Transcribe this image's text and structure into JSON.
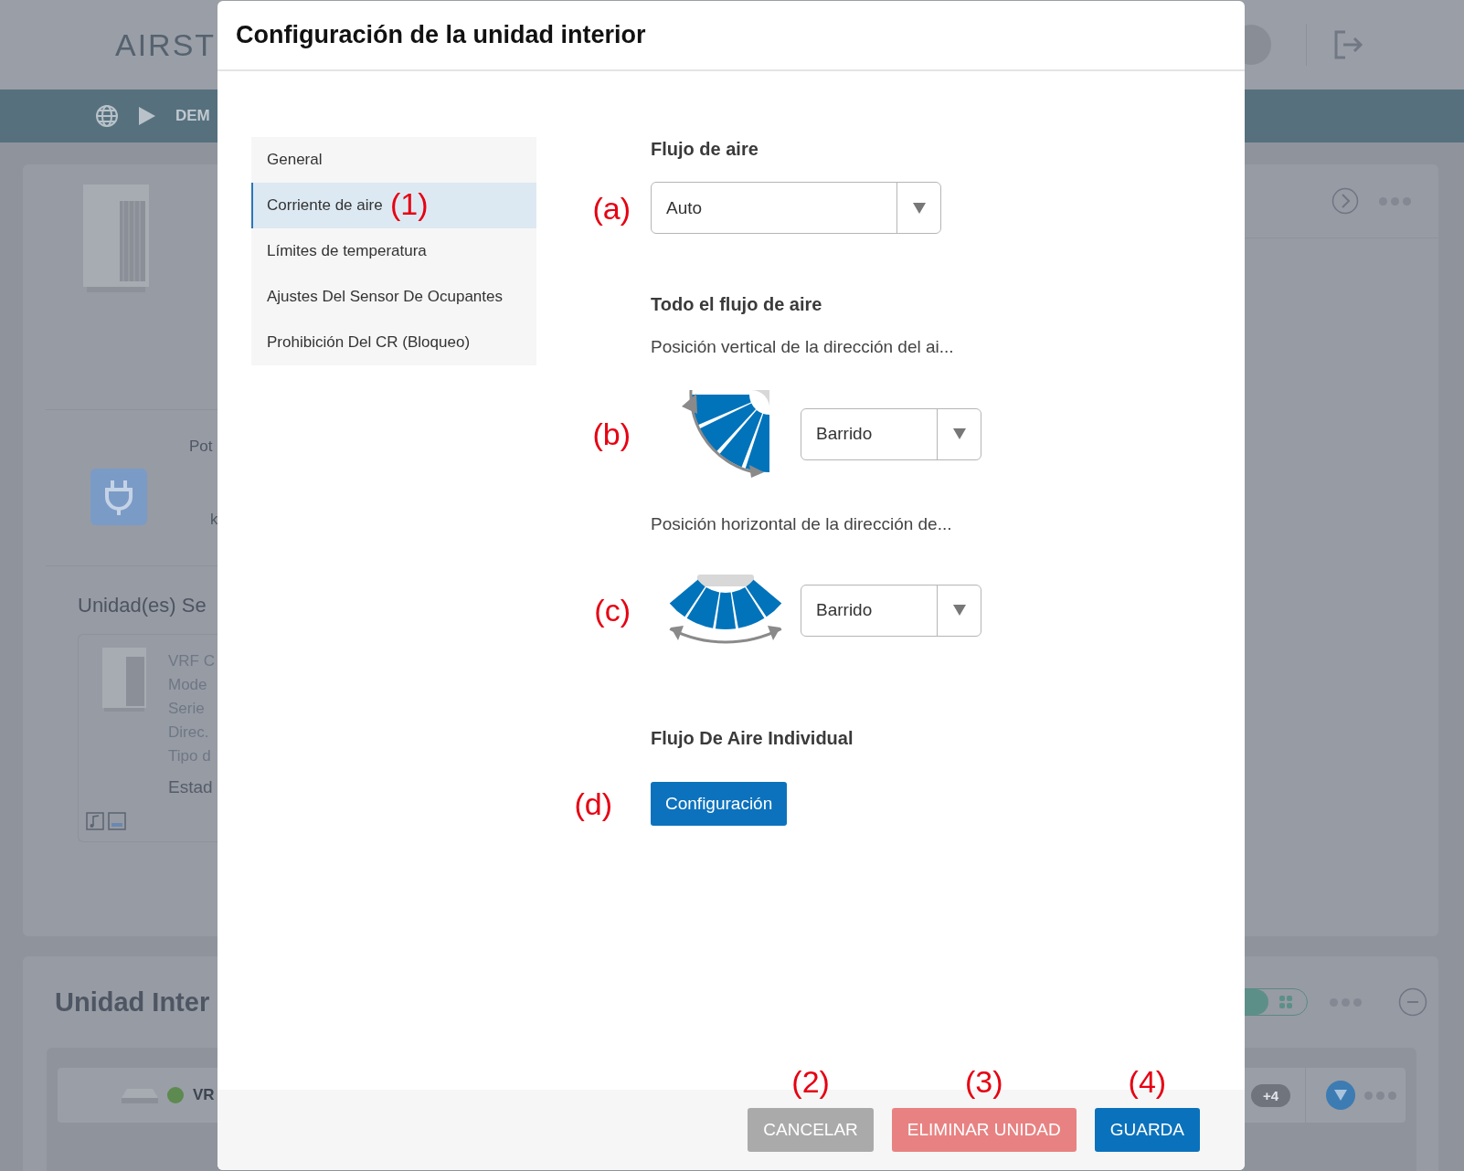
{
  "background": {
    "logo": "AIRST",
    "breadcrumb": "DEM",
    "power_label": "Pot",
    "power_unit": "k",
    "section_title": "Unidad(es) Se",
    "unit_card": {
      "lines": [
        "VRF C",
        "Mode",
        "Serie",
        "Direc.",
        "Tipo d"
      ],
      "status": "Estad"
    },
    "indoor_title": "Unidad Inter",
    "row_name": "VR",
    "row_badge": "+4"
  },
  "dialog": {
    "title": "Configuración de la unidad interior",
    "nav": [
      {
        "label": "General",
        "selected": false
      },
      {
        "label": "Corriente de aire",
        "selected": true,
        "annotation": "(1)"
      },
      {
        "label": "Límites de temperatura",
        "selected": false
      },
      {
        "label": "Ajustes Del Sensor De Ocupantes",
        "selected": false
      },
      {
        "label": "Prohibición Del CR (Bloqueo)",
        "selected": false
      }
    ],
    "airflow": {
      "heading": "Flujo de aire",
      "value": "Auto",
      "annotation": "(a)"
    },
    "all_airflow": {
      "heading": "Todo el flujo de aire",
      "directions": [
        {
          "kind": "vertical",
          "caption": "Posición vertical de la dirección del ai...",
          "value": "Barrido",
          "annotation": "(b)"
        },
        {
          "kind": "horizontal",
          "caption": "Posición horizontal de la dirección de...",
          "value": "Barrido",
          "annotation": "(c)"
        }
      ]
    },
    "individual": {
      "heading": "Flujo De Aire Individual",
      "button": "Configuración",
      "annotation": "(d)"
    },
    "buttons": [
      {
        "label": "CANCELAR",
        "kind": "cancel",
        "annotation": "(2)"
      },
      {
        "label": "ELIMINAR UNIDAD",
        "kind": "delete",
        "annotation": "(3)"
      },
      {
        "label": "GUARDA",
        "kind": "save",
        "annotation": "(4)"
      }
    ]
  }
}
